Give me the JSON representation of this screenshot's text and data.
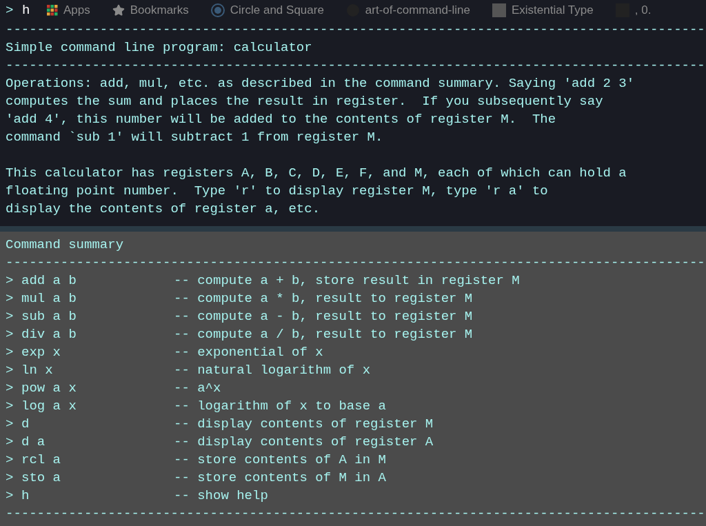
{
  "bookmarks_bar": {
    "items": [
      {
        "kind": "apps",
        "label": "Apps"
      },
      {
        "kind": "star",
        "label": "Bookmarks"
      },
      {
        "kind": "wordpress",
        "label": "Circle and Square"
      },
      {
        "kind": "github",
        "label": "art-of-command-line"
      },
      {
        "kind": "photo",
        "label": "Existential Type"
      },
      {
        "kind": "medium",
        "label": ", 0."
      }
    ]
  },
  "terminal": {
    "input_line": {
      "prompt": ">",
      "command": "h"
    },
    "rule": "-----------------------------------------------------------------------------------------",
    "title": "Simple command line program: calculator",
    "paragraphs": [
      [
        "Operations: add, mul, etc. as described in the command summary. Saying 'add 2 3'",
        "computes the sum and places the result in register.  If you subsequently say",
        "'add 4', this number will be added to the contents of register M.  The",
        "command `sub 1' will subtract 1 from register M."
      ],
      [
        "This calculator has registers A, B, C, D, E, F, and M, each of which can hold a",
        "floating point number.  Type 'r' to display register M, type 'r a' to",
        "display the contents of register a, etc."
      ]
    ],
    "summary_title": "Command summary",
    "commands": [
      {
        "prompt": ">",
        "command": "add a b",
        "description": "-- compute a + b, store result in register M"
      },
      {
        "prompt": ">",
        "command": "mul a b",
        "description": "-- compute a * b, result to register M"
      },
      {
        "prompt": ">",
        "command": "sub a b",
        "description": "-- compute a - b, result to register M"
      },
      {
        "prompt": ">",
        "command": "div a b",
        "description": "-- compute a / b, result to register M"
      },
      {
        "prompt": ">",
        "command": "exp x",
        "description": "-- exponential of x"
      },
      {
        "prompt": ">",
        "command": "ln x",
        "description": "-- natural logarithm of x"
      },
      {
        "prompt": ">",
        "command": "pow a x",
        "description": "-- a^x"
      },
      {
        "prompt": ">",
        "command": "log a x",
        "description": "-- logarithm of x to base a"
      },
      {
        "prompt": ">",
        "command": "d",
        "description": "-- display contents of register M"
      },
      {
        "prompt": ">",
        "command": "d a",
        "description": "-- display contents of register A"
      },
      {
        "prompt": ">",
        "command": "rcl a",
        "description": "-- store contents of A in M"
      },
      {
        "prompt": ">",
        "command": "sto a",
        "description": "-- store contents of M in A"
      },
      {
        "prompt": ">",
        "command": "h",
        "description": "-- show help"
      }
    ]
  }
}
